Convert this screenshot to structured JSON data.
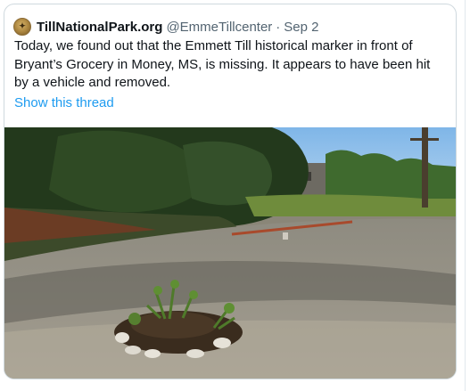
{
  "tweet": {
    "display_name": "TillNationalPark.org",
    "handle": "@EmmeTillcenter",
    "separator": "·",
    "date": "Sep 2",
    "text": "Today, we found out that the Emmett Till historical marker in front of Bryant’s Grocery in Money, MS, is missing. It appears to have been hit by a vehicle and removed.",
    "show_thread_label": "Show this thread",
    "avatar_icon": "seal-logo-icon",
    "colors": {
      "link": "#1d9bf0",
      "text": "#0f1419",
      "secondary": "#536471",
      "border": "#cfd9de"
    }
  }
}
